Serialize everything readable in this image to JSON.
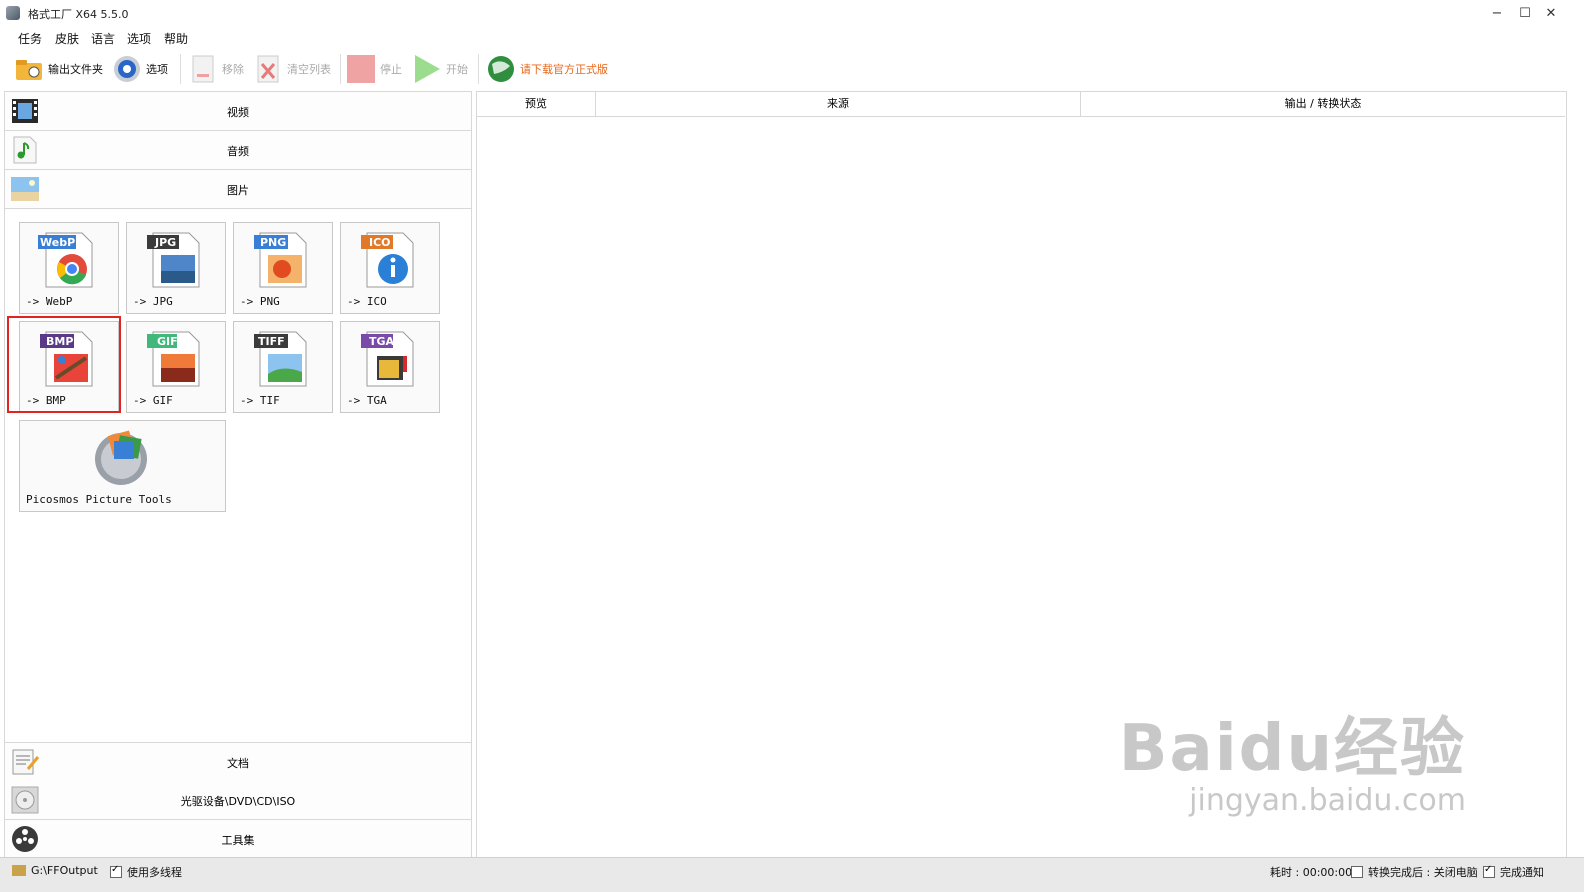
{
  "window": {
    "title": "格式工厂 X64 5.5.0",
    "min": "−",
    "max": "☐",
    "close": "✕"
  },
  "menu": [
    "任务",
    "皮肤",
    "语言",
    "选项",
    "帮助"
  ],
  "toolbar": {
    "output_folder": "输出文件夹",
    "options": "选项",
    "remove": "移除",
    "clear_list": "清空列表",
    "stop": "停止",
    "start": "开始",
    "download": "请下载官方正式版",
    "download_color": "#e8671a"
  },
  "categories": {
    "video": "视频",
    "audio": "音频",
    "picture": "图片",
    "document": "文档",
    "disc": "光驱设备\\DVD\\CD\\ISO",
    "tools": "工具集"
  },
  "tiles": [
    {
      "badge": "WebP",
      "label": "-> WebP",
      "color": "#3a7fd6",
      "icon": "chrome-icon"
    },
    {
      "badge": "JPG",
      "label": "-> JPG",
      "color": "#3b3b3b",
      "icon": "landscape-icon"
    },
    {
      "badge": "PNG",
      "label": "-> PNG",
      "color": "#3a7fd6",
      "icon": "flower-icon"
    },
    {
      "badge": "ICO",
      "label": "-> ICO",
      "color": "#e07a2a",
      "icon": "info-icon"
    },
    {
      "badge": "BMP",
      "label": "-> BMP",
      "color": "#5a3a88",
      "icon": "paint-icon"
    },
    {
      "badge": "GIF",
      "label": "-> GIF",
      "color": "#3fb87a",
      "icon": "sunset-icon"
    },
    {
      "badge": "TIFF",
      "label": "-> TIF",
      "color": "#3b3b3b",
      "icon": "meadow-icon"
    },
    {
      "badge": "TGA",
      "label": "-> TGA",
      "color": "#7a4aa8",
      "icon": "field-icon"
    }
  ],
  "picosmos": {
    "label": "Picosmos Picture Tools"
  },
  "table": {
    "col_preview": "预览",
    "col_source": "来源",
    "col_status": "输出 / 转换状态"
  },
  "status": {
    "path": "G:\\FFOutput",
    "multithread": "使用多线程",
    "elapsed": "耗时 : 00:00:00",
    "after_convert": "转换完成后 : 关闭电脑",
    "notify": "完成通知"
  },
  "watermark": {
    "brand": "Baidu经验",
    "url": "jingyan.baidu.com"
  }
}
